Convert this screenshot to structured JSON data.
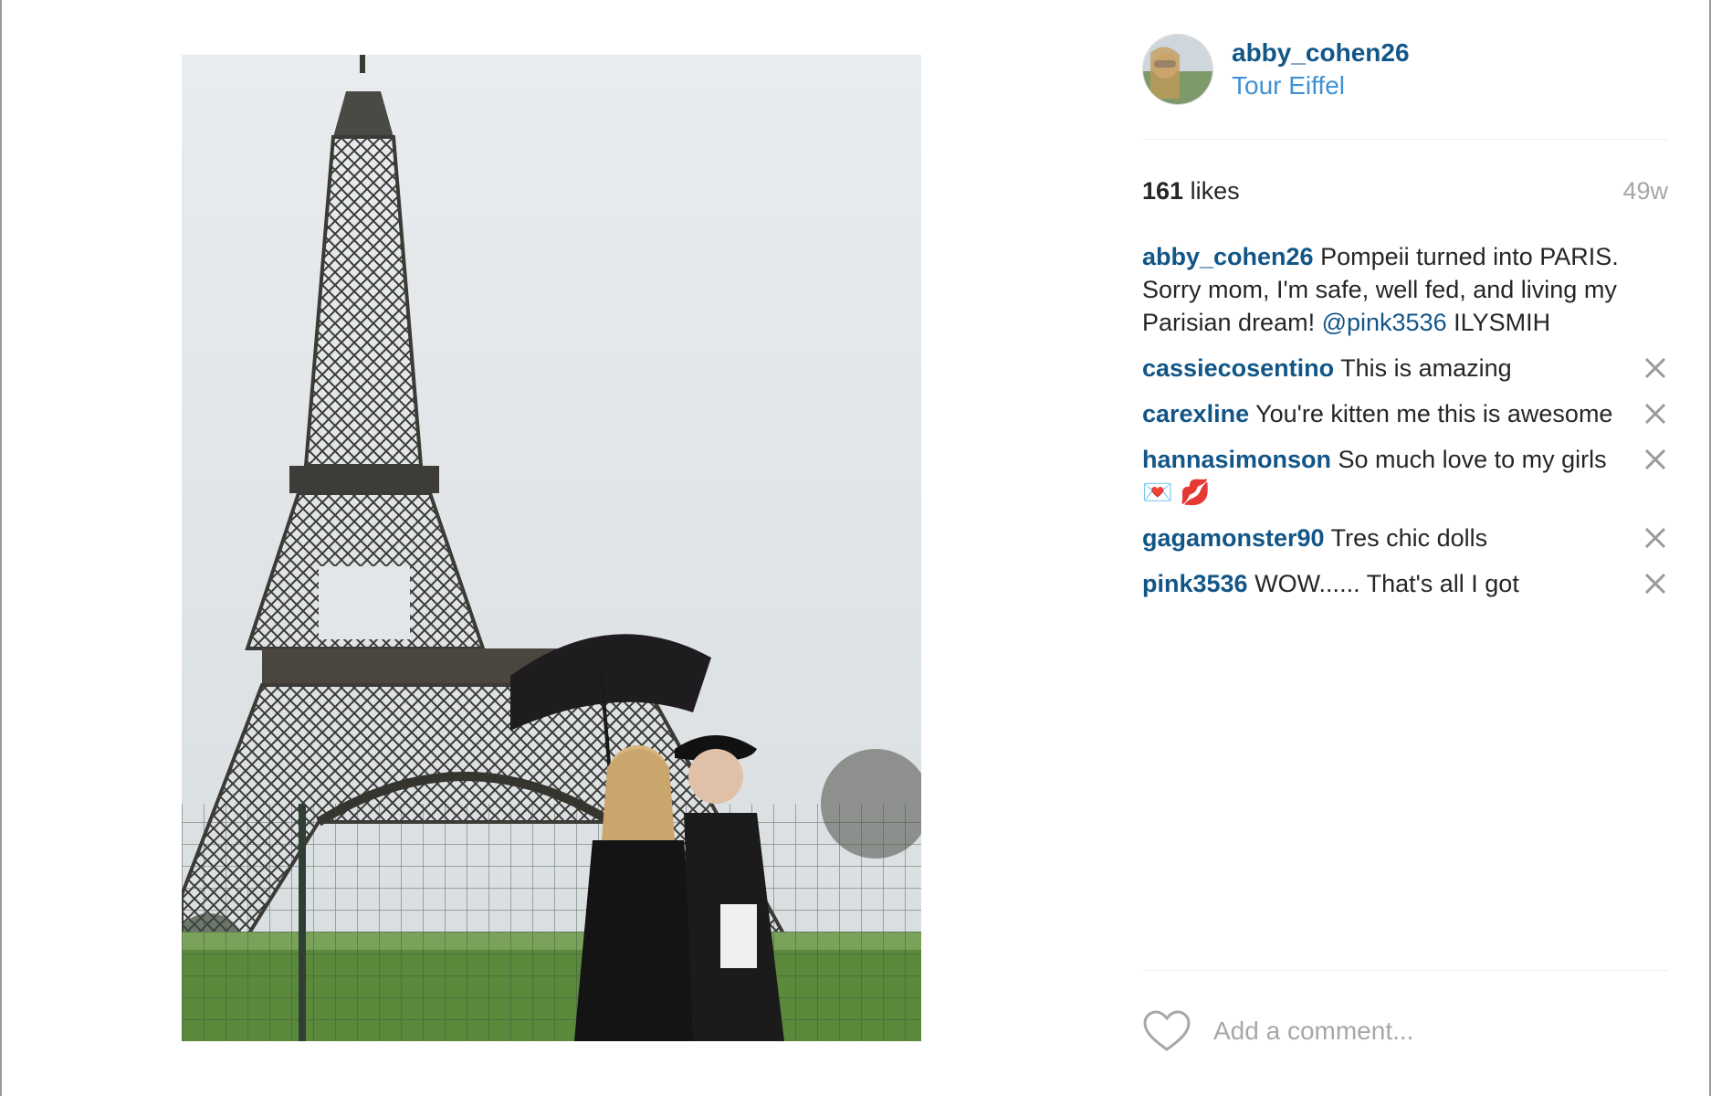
{
  "post": {
    "username": "abby_cohen26",
    "location": "Tour Eiffel",
    "likes_count": "161",
    "likes_label": "likes",
    "age": "49w"
  },
  "caption": {
    "username": "abby_cohen26",
    "text_before": " Pompeii turned into PARIS. Sorry mom, I'm safe, well fed, and living my Parisian dream! ",
    "mention": "@pink3536",
    "text_after": " ILYSMIH"
  },
  "comments": [
    {
      "username": "cassiecosentino",
      "text": " This is amazing"
    },
    {
      "username": "carexline",
      "text": " You're kitten me this is awesome"
    },
    {
      "username": "hannasimonson",
      "text": " So much love to my girls💌 💋"
    },
    {
      "username": "gagamonster90",
      "text": " Tres chic dolls"
    },
    {
      "username": "pink3536",
      "text": " WOW...... That's all I got"
    }
  ],
  "add_comment": {
    "placeholder": "Add a comment..."
  },
  "colors": {
    "username": "#125688",
    "location": "#3f91d4",
    "muted": "#a5a7aa"
  },
  "icons": {
    "delete": "close-icon",
    "like": "heart-icon"
  }
}
